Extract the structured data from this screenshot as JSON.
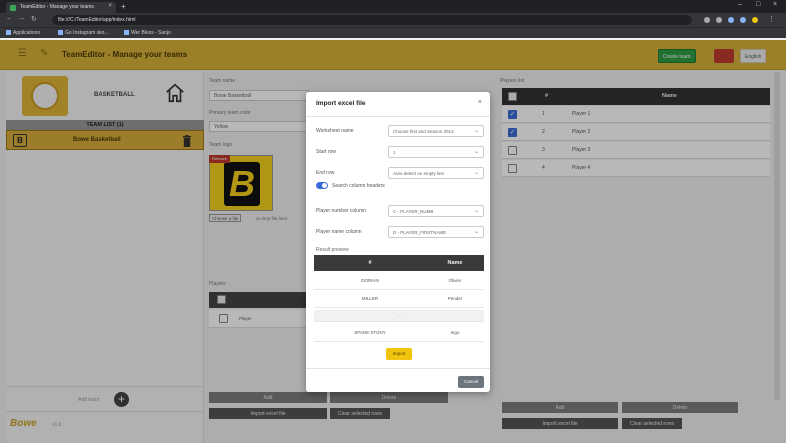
{
  "browser": {
    "tab_title": "TeamEditor - Manage your teams",
    "url": "file:///C:/TeamEditor/app/index.html",
    "bookmarks": [
      "Applications",
      "Go Instagram sko...",
      "Wer Bless - Sanjo"
    ]
  },
  "header": {
    "title": "TeamEditor - Manage your teams",
    "btn_green": "Create team",
    "btn_lang": "English"
  },
  "sidebar": {
    "sport": "BASKETBALL",
    "team_list_header": "TEAM LIST (1)",
    "team_name": "Bowe Basketball",
    "add_team_label": "Add team",
    "footer_logo": "Bowe",
    "footer_text": "v1.0"
  },
  "middle": {
    "team_name_label": "Team name",
    "team_name_value": "Bowe Basketball",
    "primary_color_label": "Primary team color",
    "primary_color_value": "Yellow",
    "team_logo_label": "Team logo",
    "logo_badge": "Remove",
    "logo_letter": "B",
    "choose_button": "Choose a file",
    "choose_text": "or drop file here",
    "players_label": "Players",
    "player_row": "Player",
    "btn_add": "Add",
    "btn_delete": "Delete",
    "btn_import": "Import excel file",
    "btn_clear": "Clear selected rows"
  },
  "players": {
    "label": "Players list",
    "header_name": "Name",
    "rows": [
      {
        "num": "1",
        "name": "Player 1",
        "checked": true
      },
      {
        "num": "2",
        "name": "Player 2",
        "checked": true
      },
      {
        "num": "3",
        "name": "Player 3",
        "checked": false
      },
      {
        "num": "4",
        "name": "Player 4",
        "checked": false
      }
    ],
    "btn_add": "Add",
    "btn_delete": "Delete",
    "btn_import": "Import excel file",
    "btn_clear": "Clear selected rows"
  },
  "modal": {
    "title": "Import excel file",
    "close": "×",
    "worksheet_label": "Worksheet name",
    "worksheet_value": "Choose first and Season 2013",
    "start_row_label": "Start row",
    "start_row_value": "1",
    "end_row_label": "End row",
    "end_row_value": "Auto-detect on empty line",
    "toggle_label": "Search column headers",
    "player_number_label": "Player number column",
    "player_number_value": "C - PLAYER_NUMB",
    "player_name_label": "Player name column",
    "player_name_value": "D - PLAYER_FIRSTNAME",
    "result_label": "Result preview",
    "result_header_num": "#",
    "result_header_name": "Name",
    "result_rows": [
      {
        "c1": "DORIAN",
        "c2": "Olivier"
      },
      {
        "c1": "MILLER",
        "c2": "Pender"
      },
      {
        "c1": "...",
        "c2": ""
      },
      {
        "c1": "SPADE STONY",
        "c2": "Ingo"
      }
    ],
    "import_button": "Import",
    "cancel_button": "Cancel"
  }
}
